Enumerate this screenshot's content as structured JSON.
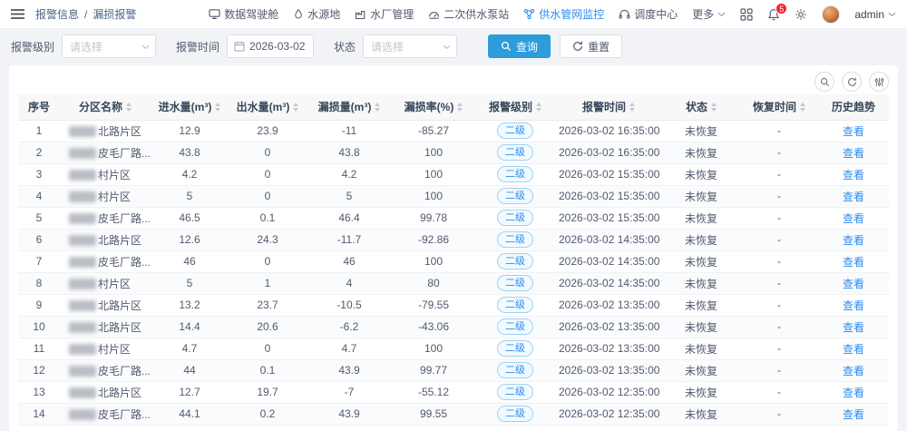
{
  "header": {
    "breadcrumb": {
      "parent": "报警信息",
      "separator": "/",
      "current": "漏损报警"
    },
    "nav": [
      {
        "label": "数据驾驶舱",
        "active": false
      },
      {
        "label": "水源地",
        "active": false
      },
      {
        "label": "水厂管理",
        "active": false
      },
      {
        "label": "二次供水泵站",
        "active": false
      },
      {
        "label": "供水管网监控",
        "active": true
      },
      {
        "label": "调度中心",
        "active": false
      },
      {
        "label": "更多",
        "active": false
      }
    ],
    "notification_count": "5",
    "username": "admin"
  },
  "filters": {
    "level": {
      "label": "报警级别",
      "placeholder": "请选择"
    },
    "time": {
      "label": "报警时间",
      "value": "2026-03-02"
    },
    "status": {
      "label": "状态",
      "placeholder": "请选择"
    },
    "search_label": "查询",
    "reset_label": "重置"
  },
  "table": {
    "columns": [
      {
        "label": "序号",
        "sortable": false
      },
      {
        "label": "分区名称",
        "sortable": true
      },
      {
        "label": "进水量(m³)",
        "sortable": true
      },
      {
        "label": "出水量(m³)",
        "sortable": true
      },
      {
        "label": "漏损量(m³)",
        "sortable": true
      },
      {
        "label": "漏损率(%)",
        "sortable": true
      },
      {
        "label": "报警级别",
        "sortable": true
      },
      {
        "label": "报警时间",
        "sortable": true
      },
      {
        "label": "状态",
        "sortable": true
      },
      {
        "label": "恢复时间",
        "sortable": true
      },
      {
        "label": "历史趋势",
        "sortable": false
      }
    ],
    "view_label": "查看",
    "rows": [
      {
        "no": "1",
        "name": "北路片区",
        "in": "12.9",
        "out": "23.9",
        "loss": "-11",
        "rate": "-85.27",
        "level": "二级",
        "time": "2026-03-02 16:35:00",
        "status": "未恢复",
        "recover": "-"
      },
      {
        "no": "2",
        "name": "皮毛厂路...",
        "in": "43.8",
        "out": "0",
        "loss": "43.8",
        "rate": "100",
        "level": "二级",
        "time": "2026-03-02 16:35:00",
        "status": "未恢复",
        "recover": "-"
      },
      {
        "no": "3",
        "name": "村片区",
        "in": "4.2",
        "out": "0",
        "loss": "4.2",
        "rate": "100",
        "level": "二级",
        "time": "2026-03-02 15:35:00",
        "status": "未恢复",
        "recover": "-"
      },
      {
        "no": "4",
        "name": "村片区",
        "in": "5",
        "out": "0",
        "loss": "5",
        "rate": "100",
        "level": "二级",
        "time": "2026-03-02 15:35:00",
        "status": "未恢复",
        "recover": "-"
      },
      {
        "no": "5",
        "name": "皮毛厂路...",
        "in": "46.5",
        "out": "0.1",
        "loss": "46.4",
        "rate": "99.78",
        "level": "二级",
        "time": "2026-03-02 15:35:00",
        "status": "未恢复",
        "recover": "-"
      },
      {
        "no": "6",
        "name": "北路片区",
        "in": "12.6",
        "out": "24.3",
        "loss": "-11.7",
        "rate": "-92.86",
        "level": "二级",
        "time": "2026-03-02 14:35:00",
        "status": "未恢复",
        "recover": "-"
      },
      {
        "no": "7",
        "name": "皮毛厂路...",
        "in": "46",
        "out": "0",
        "loss": "46",
        "rate": "100",
        "level": "二级",
        "time": "2026-03-02 14:35:00",
        "status": "未恢复",
        "recover": "-"
      },
      {
        "no": "8",
        "name": "村片区",
        "in": "5",
        "out": "1",
        "loss": "4",
        "rate": "80",
        "level": "二级",
        "time": "2026-03-02 14:35:00",
        "status": "未恢复",
        "recover": "-"
      },
      {
        "no": "9",
        "name": "北路片区",
        "in": "13.2",
        "out": "23.7",
        "loss": "-10.5",
        "rate": "-79.55",
        "level": "二级",
        "time": "2026-03-02 13:35:00",
        "status": "未恢复",
        "recover": "-"
      },
      {
        "no": "10",
        "name": "北路片区",
        "in": "14.4",
        "out": "20.6",
        "loss": "-6.2",
        "rate": "-43.06",
        "level": "二级",
        "time": "2026-03-02 13:35:00",
        "status": "未恢复",
        "recover": "-"
      },
      {
        "no": "11",
        "name": "村片区",
        "in": "4.7",
        "out": "0",
        "loss": "4.7",
        "rate": "100",
        "level": "二级",
        "time": "2026-03-02 13:35:00",
        "status": "未恢复",
        "recover": "-"
      },
      {
        "no": "12",
        "name": "皮毛厂路...",
        "in": "44",
        "out": "0.1",
        "loss": "43.9",
        "rate": "99.77",
        "level": "二级",
        "time": "2026-03-02 13:35:00",
        "status": "未恢复",
        "recover": "-"
      },
      {
        "no": "13",
        "name": "北路片区",
        "in": "12.7",
        "out": "19.7",
        "loss": "-7",
        "rate": "-55.12",
        "level": "二级",
        "time": "2026-03-02 12:35:00",
        "status": "未恢复",
        "recover": "-"
      },
      {
        "no": "14",
        "name": "皮毛厂路...",
        "in": "44.1",
        "out": "0.2",
        "loss": "43.9",
        "rate": "99.55",
        "level": "二级",
        "time": "2026-03-02 12:35:00",
        "status": "未恢复",
        "recover": "-"
      }
    ]
  },
  "colors": {
    "accent": "#2d8cf0",
    "button_blue": "#2d9cdb",
    "badge_bg": "#f0faff",
    "badge_border": "#a0d2f1",
    "notification_red": "#f5222d"
  }
}
